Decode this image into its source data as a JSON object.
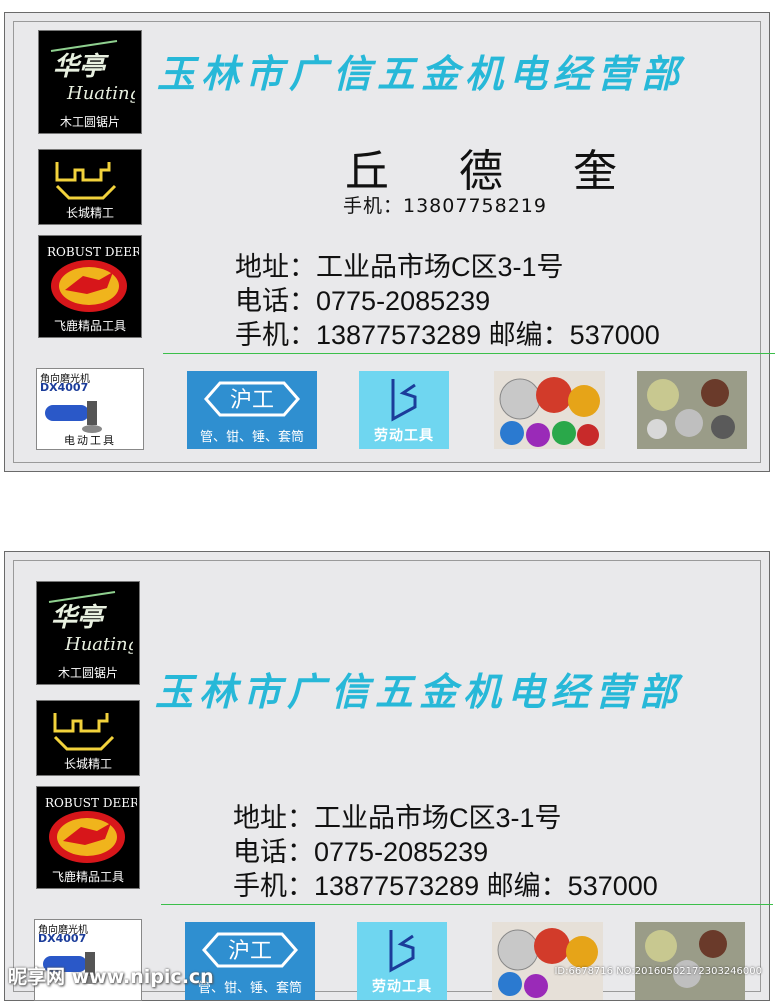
{
  "card1": {
    "logos": {
      "huating": "木工圆锯片",
      "changcheng": "长城精工",
      "robust_deer": "飞鹿精品工具"
    },
    "company": "玉林市广信五金机电经营部",
    "person": "丘 德 奎",
    "mobile_line": "手机：13807758219",
    "address": "地址：工业品市场C区3-1号",
    "phone": "电话：0775-2085239",
    "mobile_zip": "手机：13877573289 邮编：537000",
    "products": {
      "grinder_title": "角向磨光机",
      "grinder_model": "DX4007",
      "grinder_caption": "电动工具",
      "hugong_caption": "管、钳、锤、套筒",
      "laodong_caption": "劳动工具"
    }
  },
  "card2": {
    "logos": {
      "huating": "木工圆锯片",
      "changcheng": "长城精工",
      "robust_deer": "飞鹿精品工具"
    },
    "company": "玉林市广信五金机电经营部",
    "address": "地址：工业品市场C区3-1号",
    "phone": "电话：0775-2085239",
    "mobile_zip": "手机：13877573289 邮编：537000",
    "products": {
      "grinder_title": "角向磨光机",
      "grinder_model": "DX4007",
      "hugong_caption": "管、钳、锤、套筒",
      "laodong_caption": "劳动工具"
    }
  },
  "logo_text": {
    "huating_script": "Huating",
    "robust_deer": "ROBUST DEER",
    "hugong": "沪工"
  },
  "watermark": {
    "site": "昵享网 www.nipic.cn",
    "id": "ID:6678716 NO:20160502172303246000"
  },
  "colors": {
    "company": "#27b8d8",
    "card_bg": "#e9e9eb",
    "green_rule": "#3bbf4a",
    "hugong_blue": "#2f8fd0"
  }
}
